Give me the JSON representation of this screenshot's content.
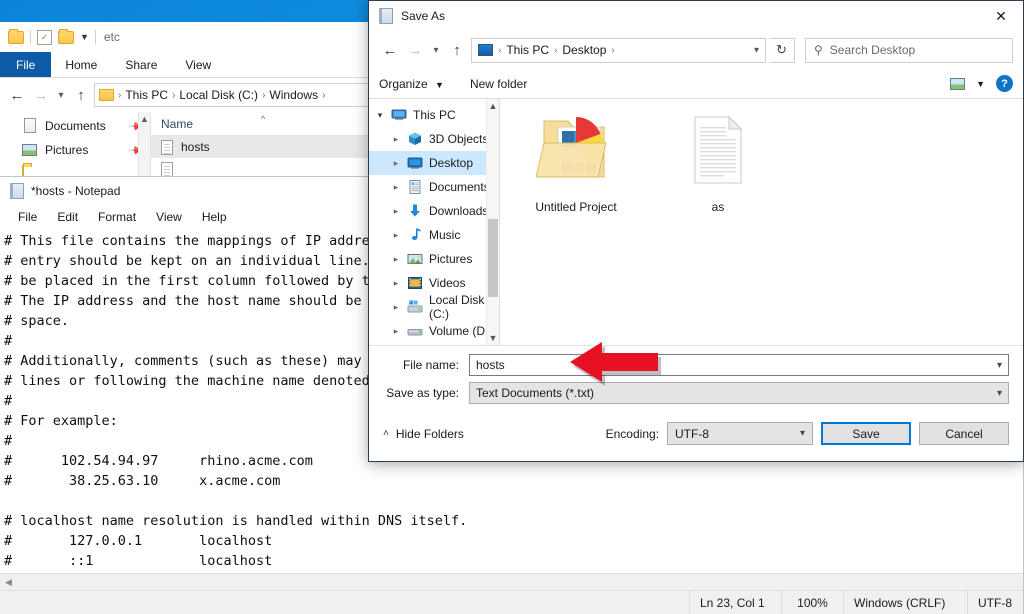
{
  "explorer": {
    "quick_access": {
      "folder_icon": "folder-icon",
      "properties_icon": "properties-icon",
      "new_folder_icon": "new-folder-icon",
      "dropdown_icon": "chevron-down-icon",
      "title": "etc"
    },
    "ribbon_tabs": [
      {
        "label": "File"
      },
      {
        "label": "Home"
      },
      {
        "label": "Share"
      },
      {
        "label": "View"
      }
    ],
    "address": {
      "back_icon": "back-arrow-icon",
      "forward_icon": "forward-arrow-icon",
      "recent_icon": "chevron-down-icon",
      "up_icon": "up-arrow-icon",
      "crumbs": [
        "This PC",
        "Local Disk (C:)",
        "Windows"
      ],
      "separator": "›"
    },
    "nav_items": [
      {
        "label": "Documents",
        "icon": "documents-icon",
        "pinned": true
      },
      {
        "label": "Pictures",
        "icon": "pictures-icon",
        "pinned": true
      }
    ],
    "column_header": "Name",
    "sort_caret": "^",
    "files": [
      {
        "name": "hosts",
        "icon": "text-file-icon"
      }
    ]
  },
  "notepad": {
    "title": "*hosts - Notepad",
    "icon": "notepad-icon",
    "menus": [
      {
        "label": "File"
      },
      {
        "label": "Edit"
      },
      {
        "label": "Format"
      },
      {
        "label": "View"
      },
      {
        "label": "Help"
      }
    ],
    "content": "# This file contains the mappings of IP addres\n# entry should be kept on an individual line. \n# be placed in the first column followed by th\n# The IP address and the host name should be s\n# space.\n#\n# Additionally, comments (such as these) may b\n# lines or following the machine name denoted \n#\n# For example:\n#\n#      102.54.94.97     rhino.acme.com\n#       38.25.63.10     x.acme.com\n\n# localhost name resolution is handled within DNS itself.\n#       127.0.0.1       localhost\n#       ::1             localhost",
    "hscroll_left_icon": "chevron-left-icon",
    "status": {
      "position": "Ln 23, Col 1",
      "zoom": "100%",
      "line_ending": "Windows (CRLF)",
      "encoding": "UTF-8"
    }
  },
  "save_dialog": {
    "title": "Save As",
    "icon": "notepad-icon",
    "close_icon": "close-icon",
    "address": {
      "back_icon": "back-arrow-icon",
      "forward_icon": "forward-arrow-icon",
      "recent_icon": "chevron-down-icon",
      "up_icon": "up-arrow-icon",
      "pc_icon": "this-pc-icon",
      "crumbs": [
        "This PC",
        "Desktop"
      ],
      "separator": "›",
      "dropdown_icon": "chevron-down-icon",
      "refresh_icon": "refresh-icon"
    },
    "search": {
      "icon": "search-icon",
      "placeholder": "Search Desktop"
    },
    "toolbar": {
      "organize_label": "Organize",
      "organize_caret": "▼",
      "new_folder_label": "New folder",
      "view_icon": "view-layout-icon",
      "view_caret": "▼",
      "help_icon": "help-icon",
      "help_glyph": "?"
    },
    "tree": [
      {
        "label": "This PC",
        "icon": "this-pc-icon",
        "level": 0,
        "expanded": true,
        "selected": false
      },
      {
        "label": "3D Objects",
        "icon": "3d-objects-icon",
        "level": 1,
        "expanded": false,
        "selected": false
      },
      {
        "label": "Desktop",
        "icon": "desktop-icon",
        "level": 1,
        "expanded": false,
        "selected": true
      },
      {
        "label": "Documents",
        "icon": "documents-icon",
        "level": 1,
        "expanded": false,
        "selected": false
      },
      {
        "label": "Downloads",
        "icon": "downloads-icon",
        "level": 1,
        "expanded": false,
        "selected": false
      },
      {
        "label": "Music",
        "icon": "music-icon",
        "level": 1,
        "expanded": false,
        "selected": false
      },
      {
        "label": "Pictures",
        "icon": "pictures-icon",
        "level": 1,
        "expanded": false,
        "selected": false
      },
      {
        "label": "Videos",
        "icon": "videos-icon",
        "level": 1,
        "expanded": false,
        "selected": false
      },
      {
        "label": "Local Disk (C:)",
        "icon": "local-disk-icon",
        "level": 1,
        "expanded": false,
        "selected": false
      },
      {
        "label": "Volume (D:)",
        "icon": "volume-drive-icon",
        "level": 1,
        "expanded": false,
        "selected": false
      }
    ],
    "tree_scroll": {
      "up_icon": "chevron-up-icon",
      "down_icon": "chevron-down-icon"
    },
    "files": [
      {
        "name": "Untitled Project",
        "icon": "folder-with-media-icon",
        "type": "folder"
      },
      {
        "name": "as",
        "icon": "text-file-icon",
        "type": "file"
      }
    ],
    "form": {
      "file_name_label": "File name:",
      "file_name_value": "hosts",
      "file_name_placeholder": "",
      "save_as_type_label": "Save as type:",
      "save_as_type_value": "Text Documents (*.txt)",
      "dropdown_icon": "chevron-down-icon"
    },
    "footer": {
      "hide_folders_label": "Hide Folders",
      "hide_folders_caret": "˄",
      "encoding_label": "Encoding:",
      "encoding_value": "UTF-8",
      "save_label": "Save",
      "cancel_label": "Cancel"
    }
  },
  "annotation": {
    "arrow_icon": "red-left-arrow-annotation",
    "color": "#e81123"
  }
}
